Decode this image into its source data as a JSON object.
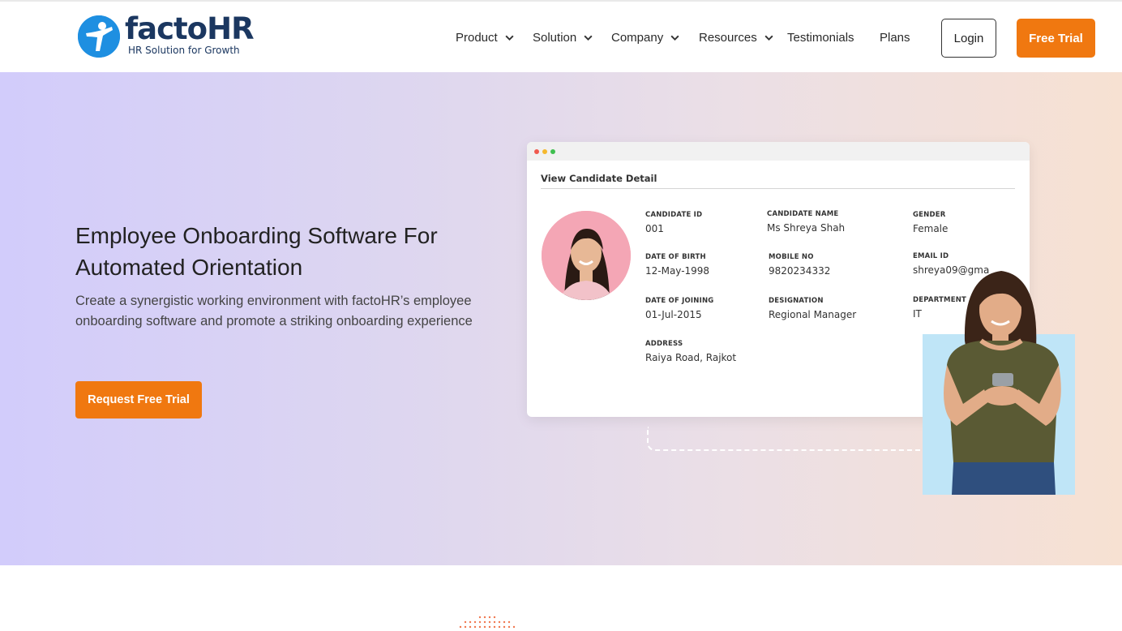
{
  "brand": {
    "name": "factoHR",
    "tagline": "HR Solution for Growth"
  },
  "nav": {
    "items": [
      {
        "label": "Product",
        "has_dropdown": true
      },
      {
        "label": "Solution",
        "has_dropdown": true
      },
      {
        "label": "Company",
        "has_dropdown": true
      },
      {
        "label": "Resources",
        "has_dropdown": true
      },
      {
        "label": "Testimonials",
        "has_dropdown": false
      },
      {
        "label": "Plans",
        "has_dropdown": false
      }
    ],
    "login_label": "Login",
    "free_trial_label": "Free Trial"
  },
  "hero": {
    "title_line1": "Employee Onboarding Software For",
    "title_line2": "Automated Orientation",
    "description": "Create a synergistic working environment with factoHR’s employee onboarding software and promote a striking onboarding experience",
    "cta_label": "Request Free Trial"
  },
  "candidate_card": {
    "title": "View Candidate Detail",
    "fields": {
      "candidate_id": {
        "label": "CANDIDATE ID",
        "value": "001"
      },
      "candidate_name": {
        "label": "CANDIDATE NAME",
        "value": "Ms Shreya Shah"
      },
      "gender": {
        "label": "GENDER",
        "value": "Female"
      },
      "dob": {
        "label": "DATE OF BIRTH",
        "value": "12-May-1998"
      },
      "mobile": {
        "label": "MOBILE NO",
        "value": "9820234332"
      },
      "email": {
        "label": "EMAIL ID",
        "value": "shreya09@gma"
      },
      "doj": {
        "label": "DATE OF JOINING",
        "value": "01-Jul-2015"
      },
      "designation": {
        "label": "DESIGNATION",
        "value": "Regional Manager"
      },
      "department": {
        "label": "DEPARTMENT",
        "value": "IT"
      },
      "address": {
        "label": "ADDRESS",
        "value": "Raiya Road, Rajkot"
      }
    }
  },
  "colors": {
    "accent_orange": "#f07810",
    "brand_navy": "#1b3760",
    "brand_blue": "#1e8fe1",
    "window_dot_red": "#f05a4f",
    "window_dot_yellow": "#f5b82e",
    "window_dot_green": "#3fbf4f"
  }
}
